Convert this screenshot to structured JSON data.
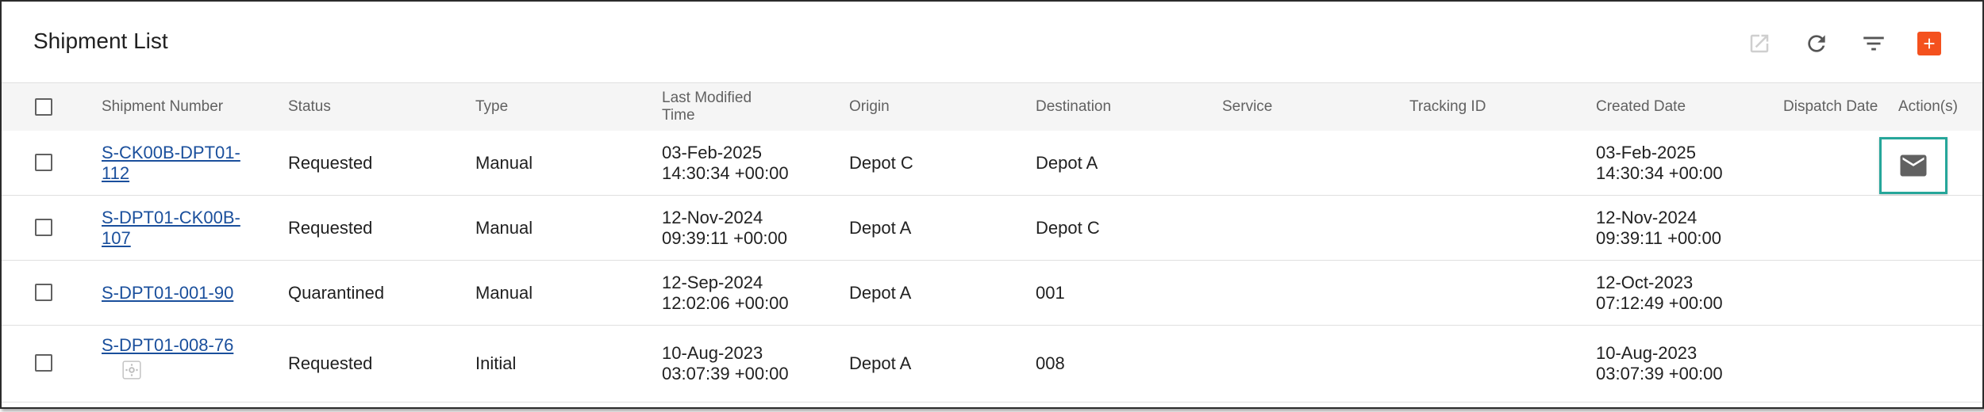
{
  "page": {
    "title": "Shipment List"
  },
  "toolbar": {
    "icons": [
      "open-in-new-icon",
      "refresh-icon",
      "filter-icon",
      "add-icon"
    ],
    "accent": "#f4511e"
  },
  "columns": {
    "shipment_number": "Shipment Number",
    "status": "Status",
    "type": "Type",
    "last_modified_1": "Last Modified",
    "last_modified_2": "Time",
    "origin": "Origin",
    "destination": "Destination",
    "service": "Service",
    "tracking_id": "Tracking ID",
    "created_date": "Created Date",
    "dispatch_date": "Dispatch Date",
    "actions": "Action(s)"
  },
  "rows": [
    {
      "number_1": "S-CK00B-DPT01-",
      "number_2": "112",
      "status": "Requested",
      "type": "Manual",
      "modified_date": "03-Feb-2025",
      "modified_time": "14:30:34 +00:00",
      "origin": "Depot C",
      "destination": "Depot A",
      "service": "",
      "tracking_id": "",
      "created_date": "03-Feb-2025",
      "created_time": "14:30:34 +00:00",
      "dispatch_date": ""
    },
    {
      "number_1": "S-DPT01-CK00B-",
      "number_2": "107",
      "status": "Requested",
      "type": "Manual",
      "modified_date": "12-Nov-2024",
      "modified_time": "09:39:11 +00:00",
      "origin": "Depot A",
      "destination": "Depot C",
      "service": "",
      "tracking_id": "",
      "created_date": "12-Nov-2024",
      "created_time": "09:39:11 +00:00",
      "dispatch_date": ""
    },
    {
      "number_1": "S-DPT01-001-90",
      "number_2": "",
      "status": "Quarantined",
      "type": "Manual",
      "modified_date": "12-Sep-2024",
      "modified_time": "12:02:06 +00:00",
      "origin": "Depot A",
      "destination": "001",
      "service": "",
      "tracking_id": "",
      "created_date": "12-Oct-2023",
      "created_time": "07:12:49 +00:00",
      "dispatch_date": ""
    },
    {
      "number_1": "S-DPT01-008-76",
      "number_2": "",
      "status": "Requested",
      "type": "Initial",
      "modified_date": "10-Aug-2023",
      "modified_time": "03:07:39 +00:00",
      "origin": "Depot A",
      "destination": "008",
      "service": "",
      "tracking_id": "",
      "created_date": "10-Aug-2023",
      "created_time": "03:07:39 +00:00",
      "dispatch_date": ""
    }
  ]
}
